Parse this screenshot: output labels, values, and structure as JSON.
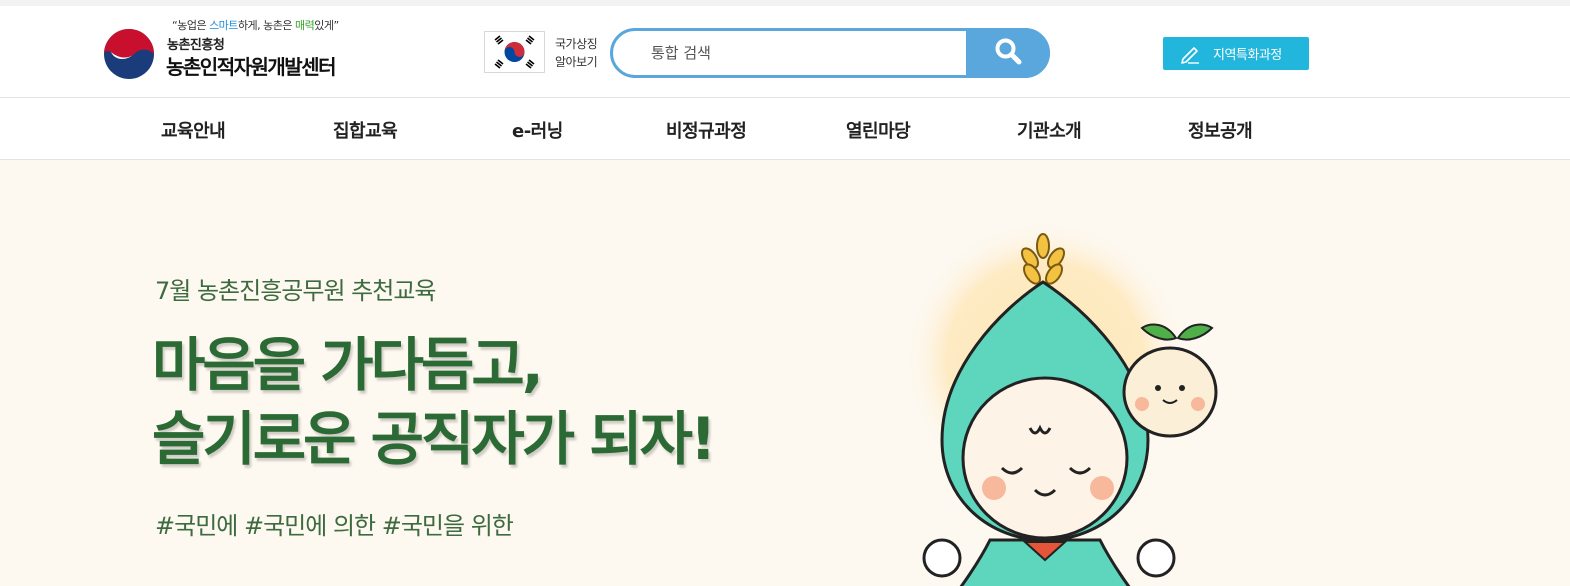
{
  "header": {
    "slogan_pre": "농업은 ",
    "slogan_smart": "스마트",
    "slogan_mid": "하게, 농촌은 ",
    "slogan_charm": "매력",
    "slogan_post": "있게",
    "org_sub": "농촌진흥청",
    "org_main": "농촌인적자원개발센터",
    "national_symbol_line1": "국가상징",
    "national_symbol_line2": "알아보기",
    "search_placeholder": "통합 검색",
    "region_button": "지역특화과정"
  },
  "nav": {
    "items": [
      "교육안내",
      "집합교육",
      "e-러닝",
      "비정규과정",
      "열린마당",
      "기관소개",
      "정보공개"
    ]
  },
  "hero": {
    "subtitle": "7월 농촌진흥공무원 추천교육",
    "title_line1": "마음을 가다듬고,",
    "title_line2": "슬기로운 공직자가 되자!",
    "tags": "#국민에 #국민에 의한 #국민을 위한"
  },
  "colors": {
    "search_blue": "#5aa7de",
    "region_button": "#22b6dd",
    "hero_bg": "#fdf8f0",
    "hero_green": "#2c6a35"
  }
}
